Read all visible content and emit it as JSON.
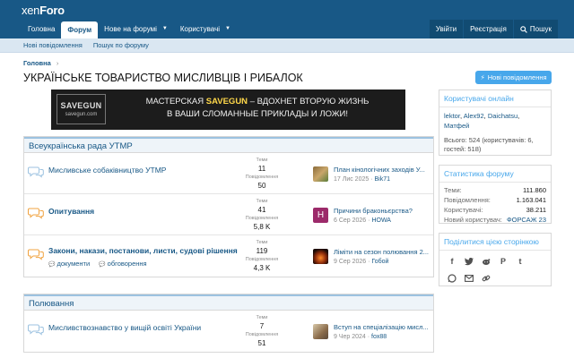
{
  "header": {
    "logo_left": "xen",
    "logo_right": "Foro"
  },
  "nav": {
    "tabs": [
      {
        "label": "Головна",
        "selected": false,
        "caret": false
      },
      {
        "label": "Форум",
        "selected": true,
        "caret": false
      },
      {
        "label": "Нове на форумі",
        "selected": false,
        "caret": true
      },
      {
        "label": "Користувачі",
        "selected": false,
        "caret": true
      }
    ],
    "login": "Увійти",
    "register": "Реєстрація",
    "search": "Пошук"
  },
  "subnav": {
    "new_posts": "Нові повідомлення",
    "search_forum": "Пошук по форуму"
  },
  "breadcrumb": {
    "home": "Головна"
  },
  "page_title": "УКРАЇНСЬКЕ ТОВАРИСТВО МИСЛИВЦІВ І РИБАЛОК",
  "new_posts_button": "Нові повідомлення",
  "banner": {
    "logo_name": "SAVEGUN",
    "logo_url": "savegun.com",
    "line1_prefix": "МАСТЕРСКАЯ",
    "line1_brand": "SAVEGUN",
    "line1_suffix": "– ВДОХНЕТ ВТОРУЮ ЖИЗНЬ",
    "line2": "В ВАШИ СЛОМАННЫЕ ПРИКЛАДЫ И ЛОЖИ!"
  },
  "categories": [
    {
      "title": "Всеукраїнська рада УТМР",
      "nodes": [
        {
          "title": "Мисливське собаківництво УТМР",
          "bold": false,
          "threads_label": "Теми",
          "threads": "11",
          "posts_label": "Повідомлення",
          "posts": "50",
          "last_title": "План кінологічних заходів У...",
          "last_date": "17 Лис 2025",
          "last_user": "Bik71",
          "avatar": "photo-dog"
        },
        {
          "title": "Опитування",
          "bold": true,
          "threads_label": "Теми",
          "threads": "41",
          "posts_label": "Повідомлення",
          "posts": "5,8 K",
          "last_title": "Причини браконьєрства?",
          "last_date": "6 Сер 2026",
          "last_user": "HOWA",
          "avatar": "H"
        },
        {
          "title": "Закони, накази, постанови, листи, судові рішення",
          "bold": true,
          "subforums": [
            "документи",
            "обговорення"
          ],
          "threads_label": "Теми",
          "threads": "119",
          "posts_label": "Повідомлення",
          "posts": "4,3 K",
          "last_title": "Ліміти на сезон полювання 2...",
          "last_date": "9 Сер 2026",
          "last_user": "Гобой",
          "avatar": "photo-fire"
        }
      ]
    },
    {
      "title": "Полювання",
      "nodes": [
        {
          "title": "Мисливствознавство у вищій освіті України",
          "bold": false,
          "threads_label": "Теми",
          "threads": "7",
          "posts_label": "Повідомлення",
          "posts": "51",
          "last_title": "Вступ на спеціалізацію мисл...",
          "last_date": "9 Чер 2024",
          "last_user": "fox88",
          "avatar": "photo-hunter"
        }
      ]
    }
  ],
  "sidebar": {
    "online": {
      "title": "Користувачі онлайн",
      "users": [
        "lektor",
        "Alex92",
        "Daichatsu",
        "Матфей"
      ],
      "total": "Всього: 524 (користувачів: 6, гостей: 518)"
    },
    "stats": {
      "title": "Статистика форуму",
      "rows": [
        {
          "k": "Теми:",
          "v": "111.860"
        },
        {
          "k": "Повідомлення:",
          "v": "1.163.041"
        },
        {
          "k": "Користувачі:",
          "v": "38.211"
        },
        {
          "k": "Новий користувач:",
          "v": "ФОРСАЖ 23"
        }
      ]
    },
    "share": {
      "title": "Поділитися цією сторінкою",
      "icons": [
        "facebook-icon",
        "twitter-icon",
        "reddit-icon",
        "pinterest-icon",
        "tumblr-icon",
        "whatsapp-icon",
        "email-icon",
        "link-icon"
      ]
    }
  },
  "colors": {
    "brand": "#185886",
    "accent": "#47a7eb",
    "link": "#185886"
  }
}
